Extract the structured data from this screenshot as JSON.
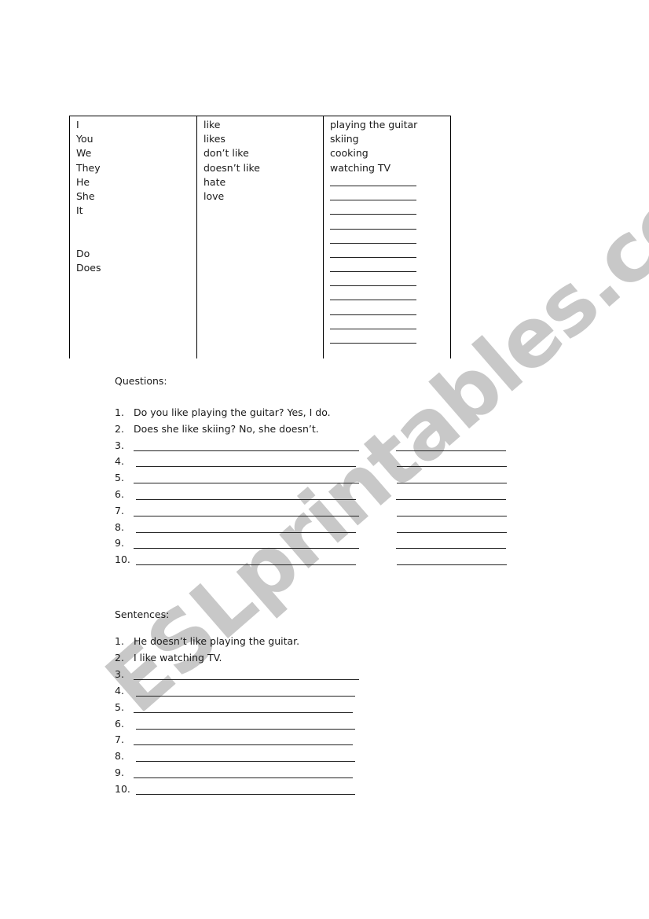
{
  "watermark": "ESLprintables.com",
  "table": {
    "subjects": [
      "I",
      "You",
      "We",
      "They",
      "He",
      "She",
      "It",
      "",
      "",
      "Do",
      "Does"
    ],
    "verbs": [
      "like",
      "likes",
      "don’t like",
      "doesn’t like",
      "hate",
      "love"
    ],
    "activities": [
      "playing the guitar",
      "skiing",
      "cooking",
      "watching TV"
    ],
    "activity_blank_count": 12
  },
  "questions": {
    "heading": "Questions:",
    "items": [
      {
        "number": "1.",
        "text": "Do you like playing the guitar? Yes, I do."
      },
      {
        "number": "2.",
        "text": "Does she like skiing?  No, she doesn’t."
      },
      {
        "number": "3.",
        "text": ""
      },
      {
        "number": "4.",
        "text": ""
      },
      {
        "number": "5.",
        "text": ""
      },
      {
        "number": "6.",
        "text": ""
      },
      {
        "number": "7.",
        "text": ""
      },
      {
        "number": "8.",
        "text": ""
      },
      {
        "number": "9.",
        "text": ""
      },
      {
        "number": "10.",
        "text": ""
      }
    ]
  },
  "sentences": {
    "heading": "Sentences:",
    "items": [
      {
        "number": "1.",
        "text": "He doesn’t like playing the guitar."
      },
      {
        "number": "2.",
        "text": "I like watching TV."
      },
      {
        "number": "3.",
        "text": ""
      },
      {
        "number": "4.",
        "text": ""
      },
      {
        "number": "5.",
        "text": ""
      },
      {
        "number": "6.",
        "text": ""
      },
      {
        "number": "7.",
        "text": ""
      },
      {
        "number": "8.",
        "text": ""
      },
      {
        "number": "9.",
        "text": ""
      },
      {
        "number": "10.",
        "text": ""
      }
    ]
  }
}
